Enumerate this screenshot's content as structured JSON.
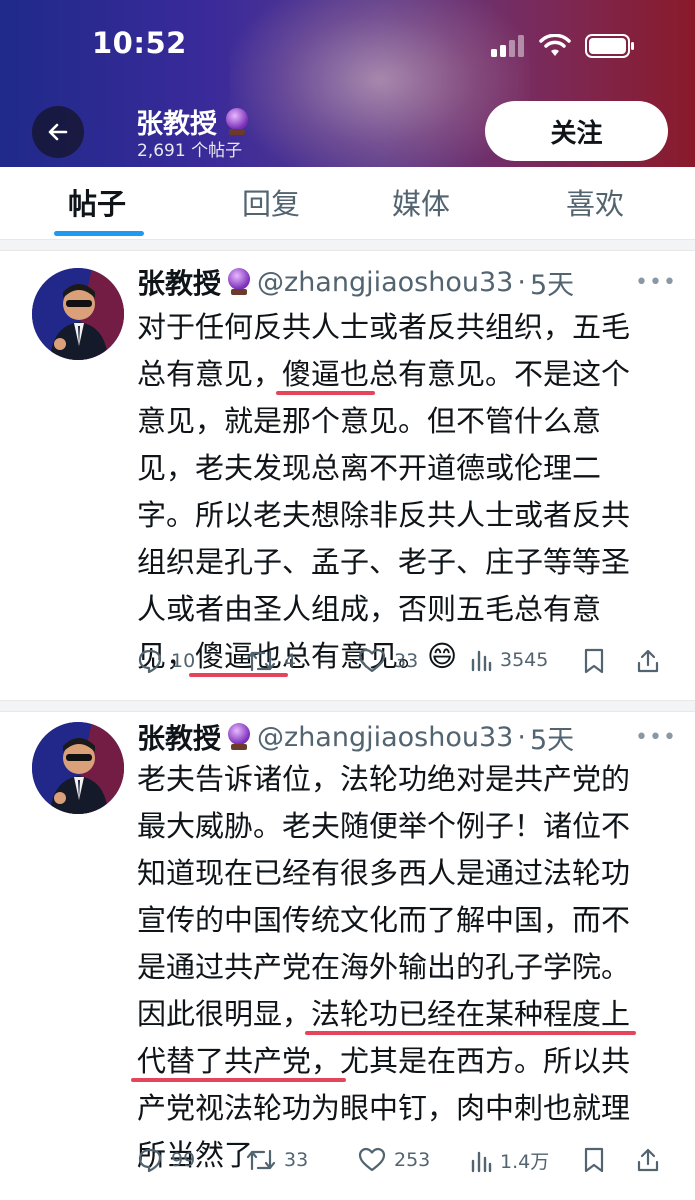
{
  "status_bar": {
    "time": "10:52"
  },
  "profile": {
    "name": "张教授",
    "badge_icon": "crystal-ball-icon",
    "post_count": "2,691 个帖子",
    "follow_label": "关注"
  },
  "tabs": [
    {
      "label": "帖子",
      "active": true
    },
    {
      "label": "回复",
      "active": false
    },
    {
      "label": "媒体",
      "active": false
    },
    {
      "label": "喜欢",
      "active": false
    }
  ],
  "posts": [
    {
      "author": "张教授",
      "handle": "@zhangjiaoshou33",
      "dot": "·",
      "time": "5天",
      "lines": [
        "对于任何反共人士或者反共组织，五毛",
        "总有意见，",
        "傻逼也",
        "总有意见。不是这个",
        "意见，就是那个意见。但不管什么意",
        "见，老夫发现总离不开道德或伦理二",
        "字。所以老夫想除非反共人士或者反共",
        "组织是孔子、孟子、老子、庄子等等圣",
        "人或者由圣人组成，否则五毛总有意",
        "见，",
        "傻逼也",
        "总有意见。😄"
      ],
      "replies": "10",
      "reposts": "4",
      "likes": "33",
      "views": "3545"
    },
    {
      "author": "张教授",
      "handle": "@zhangjiaoshou33",
      "dot": "·",
      "time": "5天",
      "lines": [
        "老夫告诉诸位，法轮功绝对是共产党的",
        "最大威胁。老夫随便举个例子！诸位不",
        "知道现在已经有很多西人是通过法轮功",
        "宣传的中国传统文化而了解中国，而不",
        "是通过共产党在海外输出的孔子学院。",
        "因此很明显，",
        "法轮功已经在某种程度上",
        "代替了共产党，",
        "尤其是在西方。所以共",
        "产党视法轮功为眼中钉，肉中刺也就理",
        "所当然了"
      ],
      "replies": "99",
      "reposts": "33",
      "likes": "253",
      "views": "1.4万"
    }
  ],
  "colors": {
    "accent": "#1d9bf0",
    "underline_annotation": "#e5455a"
  }
}
